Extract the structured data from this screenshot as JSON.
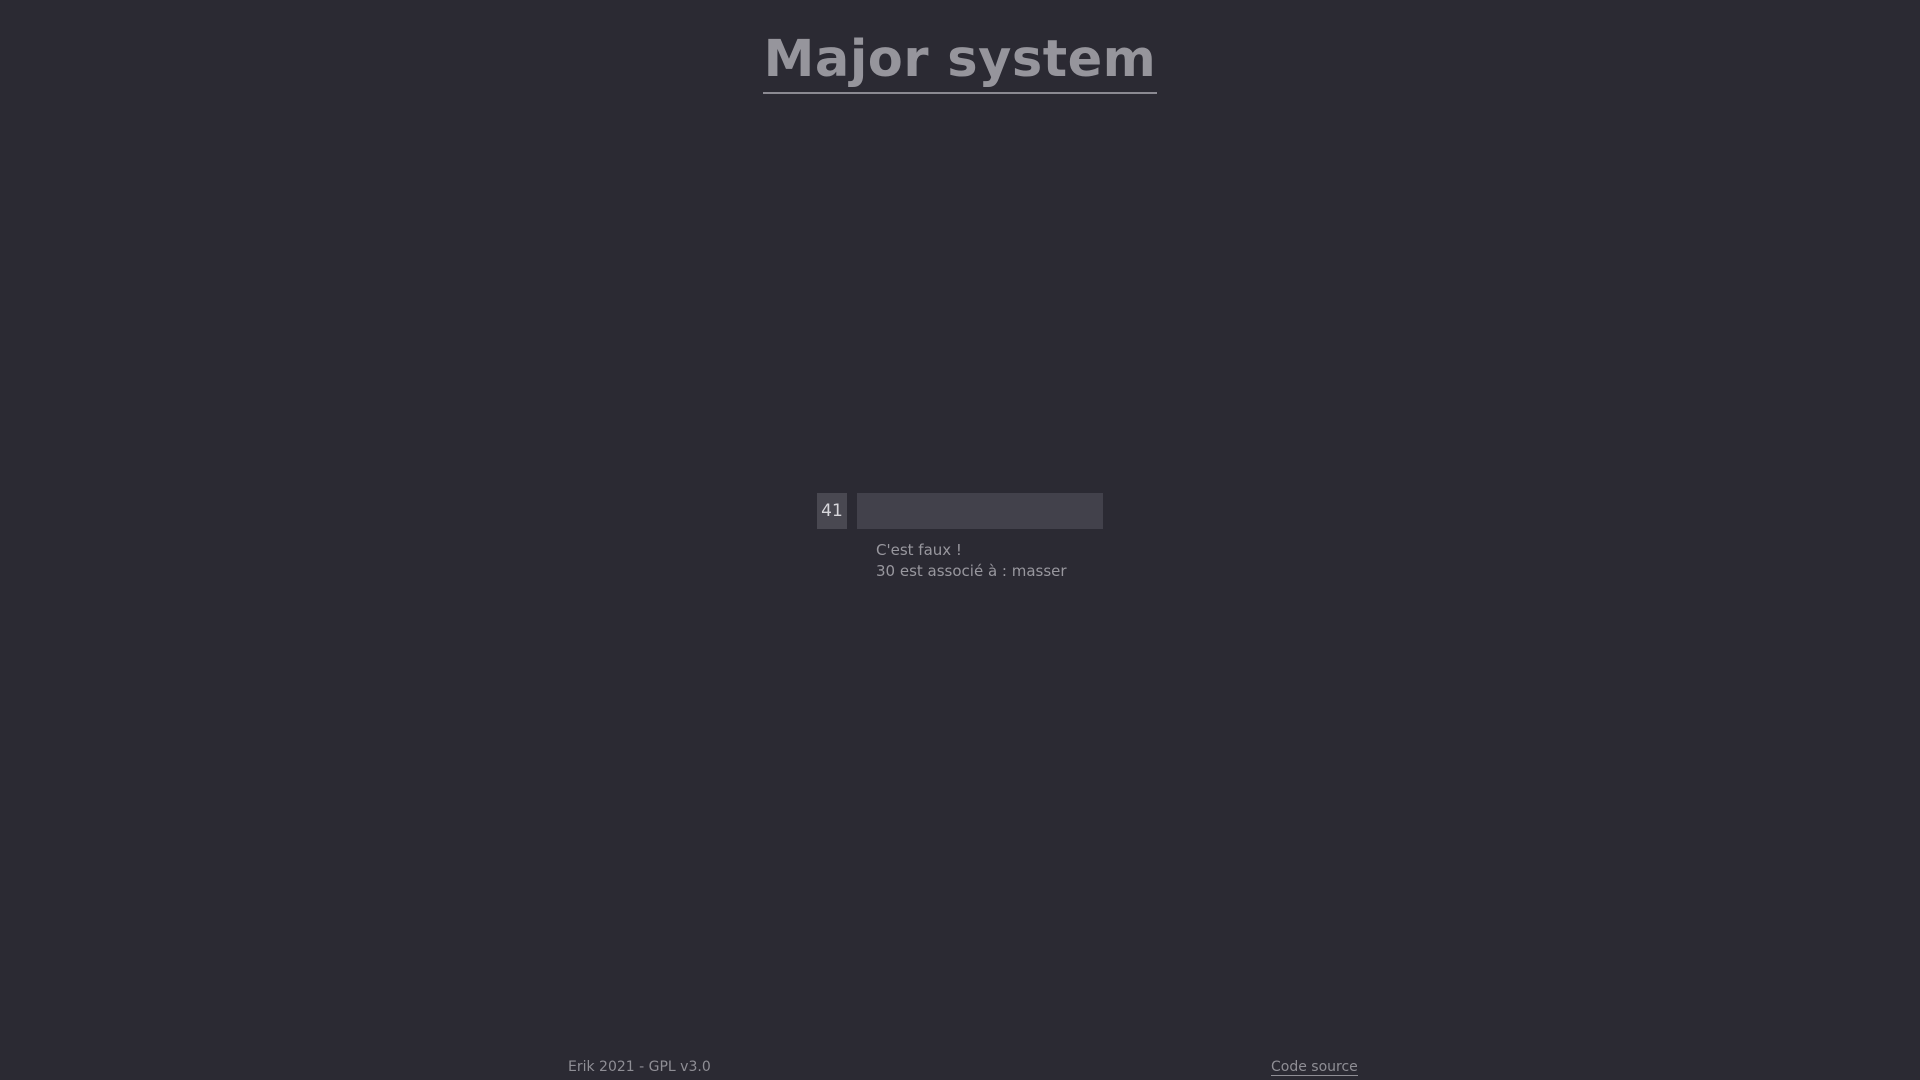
{
  "header": {
    "title": "Major system"
  },
  "quiz": {
    "number": "41",
    "answer_value": "",
    "answer_placeholder": ""
  },
  "feedback": {
    "status": "C'est faux !",
    "correction": "30 est associé à : masser"
  },
  "footer": {
    "credits": "Erik 2021 - GPL v3.0",
    "source_link": "Code source"
  }
}
